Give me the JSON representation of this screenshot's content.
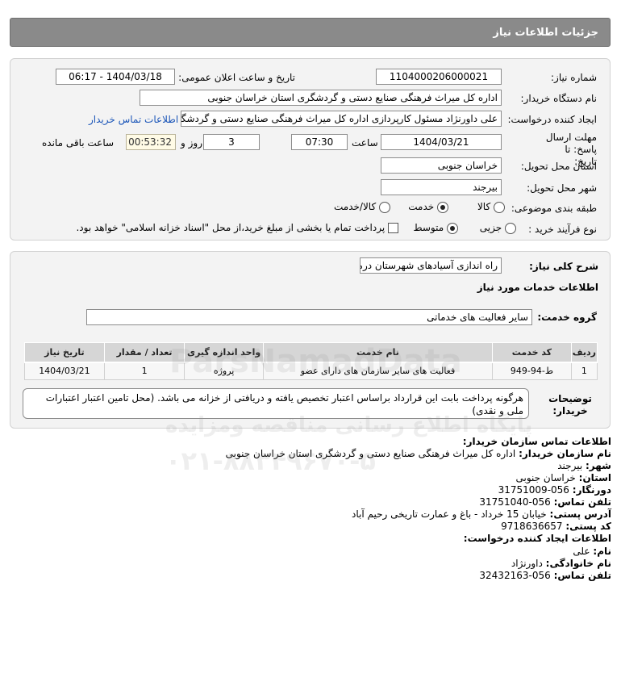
{
  "header": {
    "title": "جزئیات اطلاعات نیاز"
  },
  "form": {
    "need_number_label": "شماره نیاز:",
    "need_number": "1104000206000021",
    "announce_label": "تاریخ و ساعت اعلان عمومی:",
    "announce_value": "1404/03/18 - 06:17",
    "buyer_org_label": "نام دستگاه خریدار:",
    "buyer_org": "اداره کل میراث فرهنگی  صنایع دستی و گردشگری استان خراسان جنوبی",
    "creator_label": "ایجاد کننده درخواست:",
    "creator": "علی داورنژاد مسئول کارپردازی اداره کل میراث فرهنگی  صنایع دستی و گردشگری",
    "contact_link": "اطلاعات تماس خریدار",
    "deadline_label": "مهلت ارسال پاسخ: تا تاریخ:",
    "deadline_date": "1404/03/21",
    "time_label": "ساعت",
    "deadline_time": "07:30",
    "days_value": "3",
    "days_label": "روز و",
    "remaining_time": "00:53:32",
    "remaining_label": "ساعت باقی مانده",
    "province_label": "استان محل تحویل:",
    "province": "خراسان جنوبی",
    "city_label": "شهر محل تحویل:",
    "city": "بیرجند",
    "category_label": "طبقه بندی موضوعی:",
    "category_options": [
      "کالا",
      "خدمت",
      "کالا/خدمت"
    ],
    "process_label": "نوع فرآیند خرید :",
    "process_options": [
      "جزیی",
      "متوسط"
    ],
    "payment_note": "پرداخت تمام یا بخشی از مبلغ خرید،از محل \"اسناد خزانه اسلامی\" خواهد بود."
  },
  "details": {
    "summary_label": "شرح کلی نیاز:",
    "summary": "راه اندازی آسیادهای شهرستان درمیان",
    "services_title": "اطلاعات خدمات مورد نیاز",
    "service_group_label": "گروه خدمت:",
    "service_group": "سایر فعالیت های خدماتی",
    "table": {
      "headers": [
        "ردیف",
        "کد خدمت",
        "نام خدمت",
        "واحد اندازه گیری",
        "تعداد / مقدار",
        "تاریخ نیاز"
      ],
      "rows": [
        [
          "1",
          "ط-94-949",
          "فعالیت های سایر سازمان های دارای عضو",
          "پروژه",
          "1",
          "1404/03/21"
        ]
      ]
    },
    "buyer_notes_label": "توضیحات خریدار:",
    "buyer_notes": "هرگونه پرداخت بابت این قرارداد براساس اعتبار تخصیص یافته و دریافتی از خزانه می باشد. (محل تامین اعتبار اعتبارات ملی و نقدی)"
  },
  "contact": {
    "title": "اطلاعات تماس سازمان خریدار:",
    "org_label": "نام سازمان خریدار:",
    "org": "اداره کل میراث فرهنگی صنایع دستی و گردشگری استان خراسان جنوبی",
    "city_label": "شهر:",
    "city": "بیرجند",
    "province_label": "استان:",
    "province": "خراسان جنوبی",
    "fax_label": "دورنگار:",
    "fax": "056-31751009",
    "phone_label": "تلفن تماس:",
    "phone": "056-31751040",
    "address_label": "آدرس پستی:",
    "address": "خیابان 15 خرداد - باغ و عمارت تاریخی رحیم آباد",
    "postal_label": "کد پستی:",
    "postal": "9718636657",
    "creator_title": "اطلاعات ایجاد کننده درخواست:",
    "name_label": "نام:",
    "name": "علی",
    "family_label": "نام خانوادگی:",
    "family": "داورنژاد",
    "creator_phone_label": "تلفن تماس:",
    "creator_phone": "056-32432163"
  },
  "watermark": {
    "brand": "ParsNamadData",
    "line1": "پایگاه اطلاع رسانی مناقصه ومزایده",
    "phone": "۰۲۱-۸۸۳۴۹۶۷۰-۵"
  }
}
